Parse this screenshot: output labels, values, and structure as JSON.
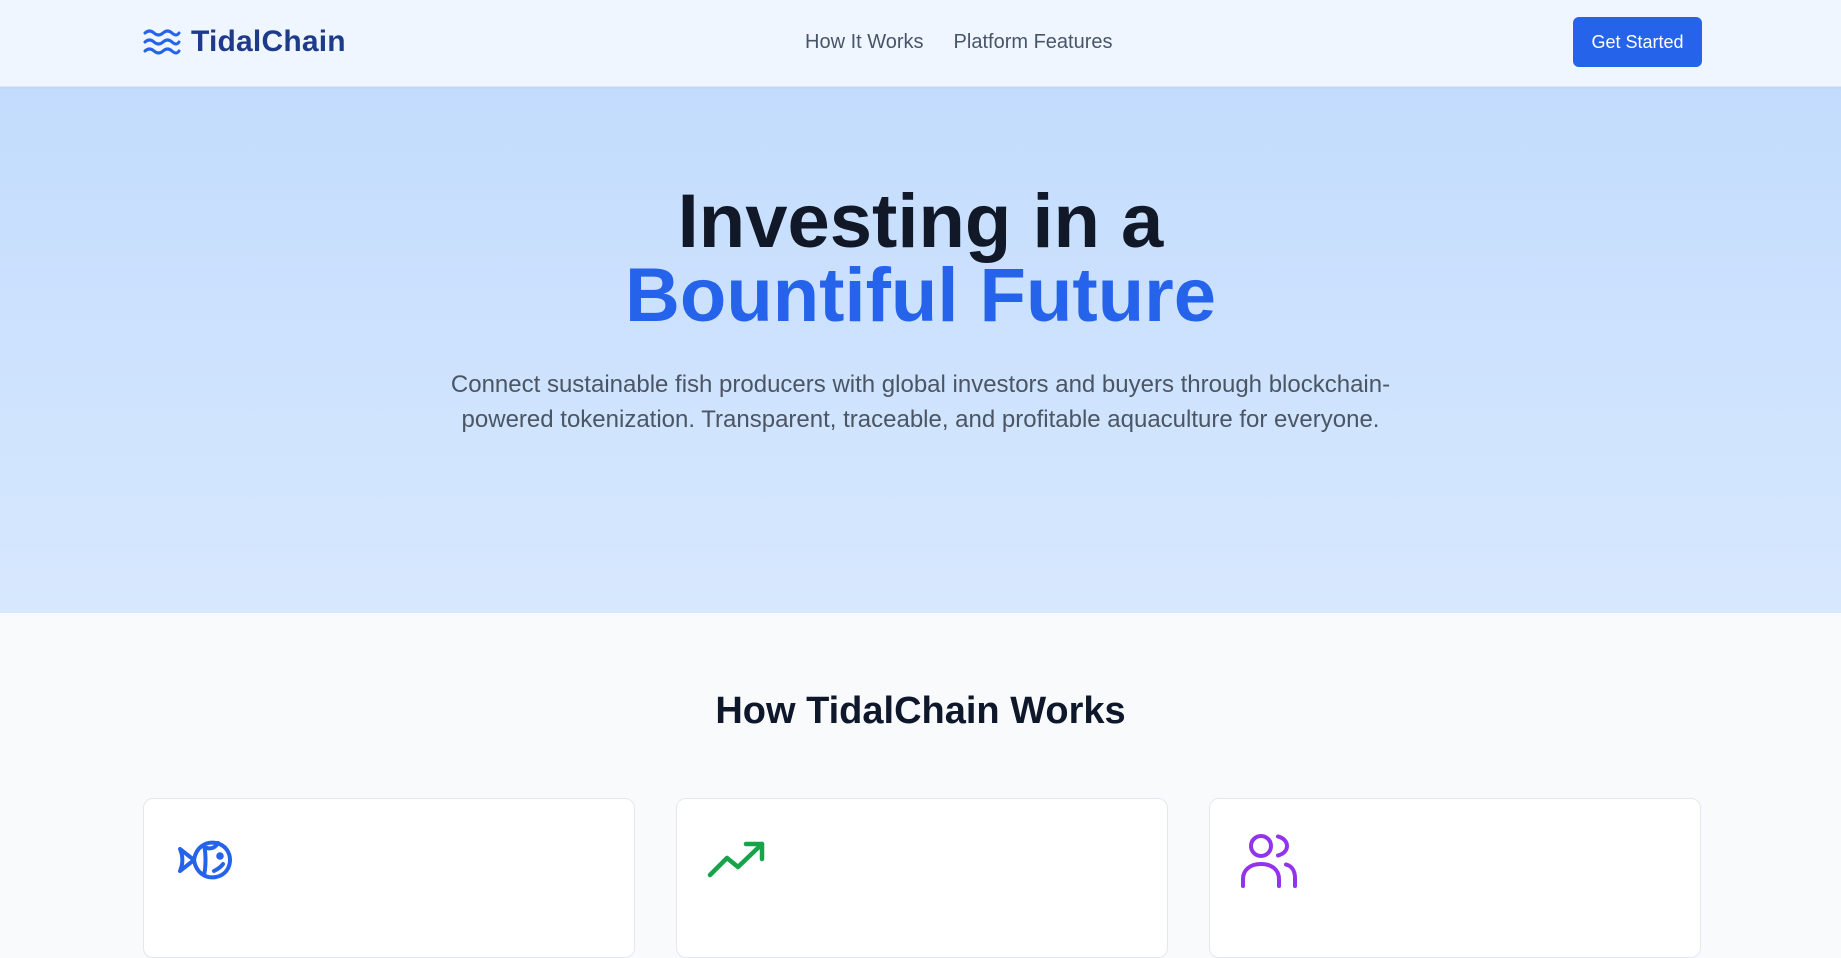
{
  "header": {
    "brand_name": "TidalChain",
    "brand_icon": "waves-icon",
    "nav": [
      {
        "label": "How It Works"
      },
      {
        "label": "Platform Features"
      }
    ],
    "cta_label": "Get Started"
  },
  "hero": {
    "title_line1": "Investing in a",
    "title_line2": "Bountiful Future",
    "subtitle": "Connect sustainable fish producers with global investors and buyers through blockchain-powered tokenization. Transparent, traceable, and profitable aquaculture for everyone."
  },
  "how_it_works": {
    "title": "How TidalChain Works",
    "cards": [
      {
        "icon": "fish-icon",
        "color": "#2563eb"
      },
      {
        "icon": "trending-up-icon",
        "color": "#16a34a"
      },
      {
        "icon": "users-icon",
        "color": "#9333ea"
      }
    ]
  },
  "colors": {
    "primary": "#2563eb",
    "brand_text": "#1e3a8a",
    "heading": "#111827"
  }
}
